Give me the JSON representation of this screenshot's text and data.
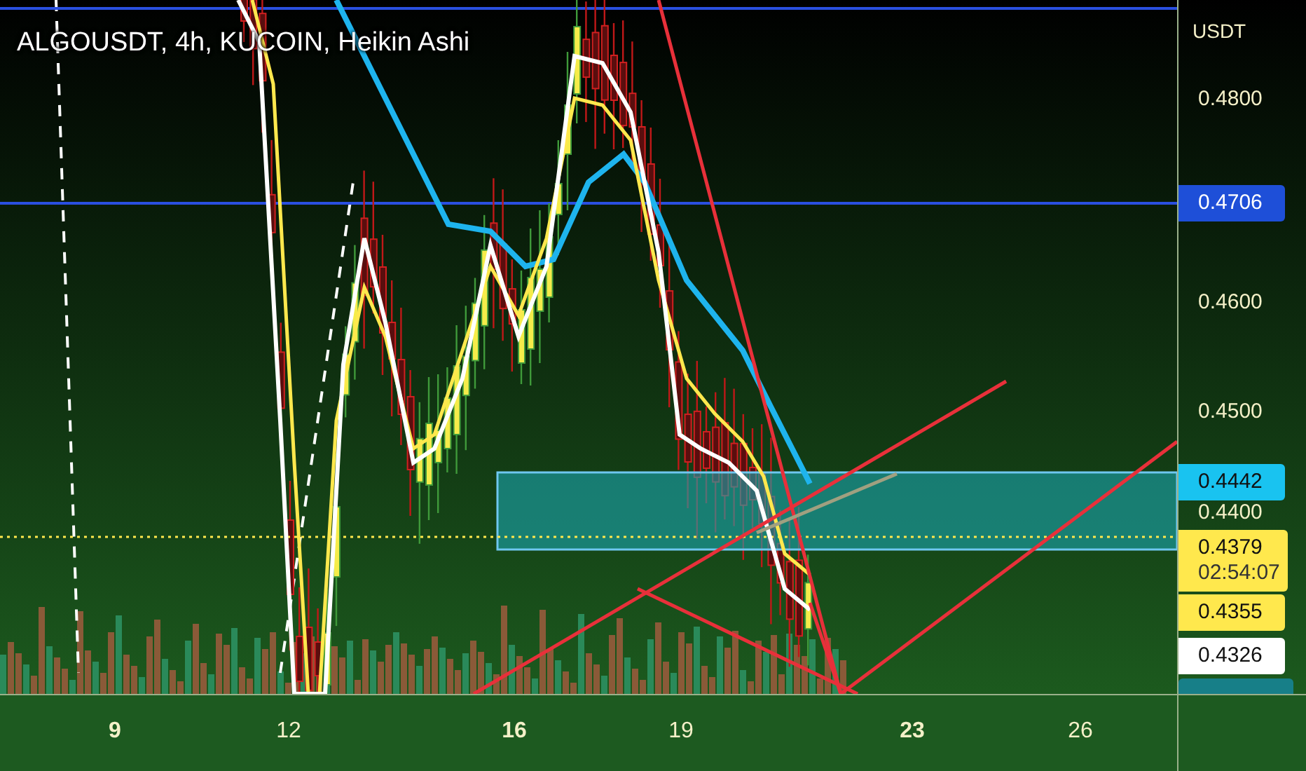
{
  "chart": {
    "title": "ALGOUSDT, 4h, KUCOIN, Heikin Ashi"
  },
  "price_axis": {
    "unit": "USDT",
    "ticks": [
      "0.4800",
      "0.4600",
      "0.4500",
      "0.4400"
    ]
  },
  "price_labels": [
    {
      "kind": "line",
      "text": "0.4706",
      "color": "#1e4fd8"
    },
    {
      "kind": "zone",
      "text": "0.4442",
      "color": "#19c3f0"
    },
    {
      "kind": "last",
      "text": "0.4379",
      "countdown": "02:54:07",
      "color": "#ffe84d"
    },
    {
      "kind": "ma",
      "text": "0.4355",
      "color": "#ffe84d"
    },
    {
      "kind": "ma",
      "text": "0.4326",
      "color": "#ffffff"
    }
  ],
  "time_axis": [
    {
      "label": "9",
      "bold": true
    },
    {
      "label": "12",
      "bold": false
    },
    {
      "label": "16",
      "bold": true
    },
    {
      "label": "19",
      "bold": false
    },
    {
      "label": "23",
      "bold": true
    },
    {
      "label": "26",
      "bold": false
    }
  ]
}
